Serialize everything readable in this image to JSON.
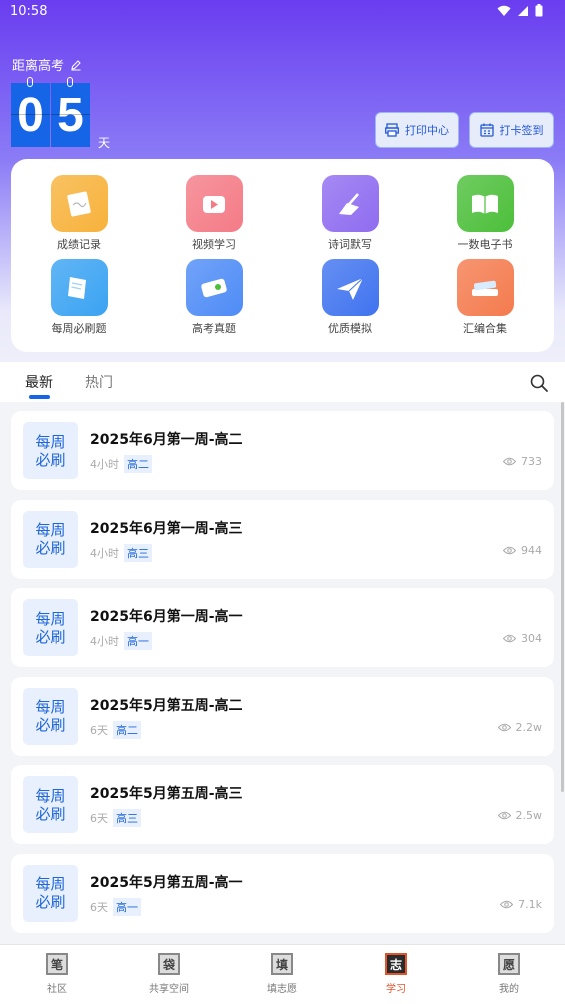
{
  "status": {
    "time": "10:58"
  },
  "countdown": {
    "label": "距离高考",
    "digits": [
      "0",
      "5"
    ],
    "unit": "天"
  },
  "actions": {
    "print_label": "打印中心",
    "checkin_label": "打卡签到"
  },
  "grid": [
    {
      "label": "成绩记录",
      "icon": "notepad-icon",
      "color": "#f7b23b"
    },
    {
      "label": "视频学习",
      "icon": "video-icon",
      "color": "#f47b86"
    },
    {
      "label": "诗词默写",
      "icon": "quill-icon",
      "color": "#8f6cf0"
    },
    {
      "label": "一数电子书",
      "icon": "book-icon",
      "color": "#4cbf3a"
    },
    {
      "label": "每周必刷题",
      "icon": "paper-icon",
      "color": "#3aa3f2"
    },
    {
      "label": "高考真题",
      "icon": "scroll-icon",
      "color": "#4e8cf6"
    },
    {
      "label": "优质模拟",
      "icon": "paper-plane-icon",
      "color": "#3f73ef"
    },
    {
      "label": "汇编合集",
      "icon": "books-icon",
      "color": "#f47b4e"
    }
  ],
  "tabs": {
    "latest": "最新",
    "hot": "热门"
  },
  "feed": [
    {
      "thumb": [
        "每周",
        "必刷"
      ],
      "title": "2025年6月第一周-高二",
      "time": "4小时",
      "tag": "高二",
      "views": "733"
    },
    {
      "thumb": [
        "每周",
        "必刷"
      ],
      "title": "2025年6月第一周-高三",
      "time": "4小时",
      "tag": "高三",
      "views": "944"
    },
    {
      "thumb": [
        "每周",
        "必刷"
      ],
      "title": "2025年6月第一周-高一",
      "time": "4小时",
      "tag": "高一",
      "views": "304"
    },
    {
      "thumb": [
        "每周",
        "必刷"
      ],
      "title": "2025年5月第五周-高二",
      "time": "6天",
      "tag": "高二",
      "views": "2.2w"
    },
    {
      "thumb": [
        "每周",
        "必刷"
      ],
      "title": "2025年5月第五周-高三",
      "time": "6天",
      "tag": "高三",
      "views": "2.5w"
    },
    {
      "thumb": [
        "每周",
        "必刷"
      ],
      "title": "2025年5月第五周-高一",
      "time": "6天",
      "tag": "高一",
      "views": "7.1k"
    }
  ],
  "nav": [
    {
      "label": "社区",
      "glyph": "笔",
      "active": false
    },
    {
      "label": "共享空间",
      "glyph": "袋",
      "active": false
    },
    {
      "label": "填志愿",
      "glyph": "填",
      "active": false
    },
    {
      "label": "学习",
      "glyph": "志",
      "active": true
    },
    {
      "label": "我的",
      "glyph": "愿",
      "active": false
    }
  ],
  "colors": {
    "accent": "#1565e6",
    "active_nav": "#e0552b"
  }
}
